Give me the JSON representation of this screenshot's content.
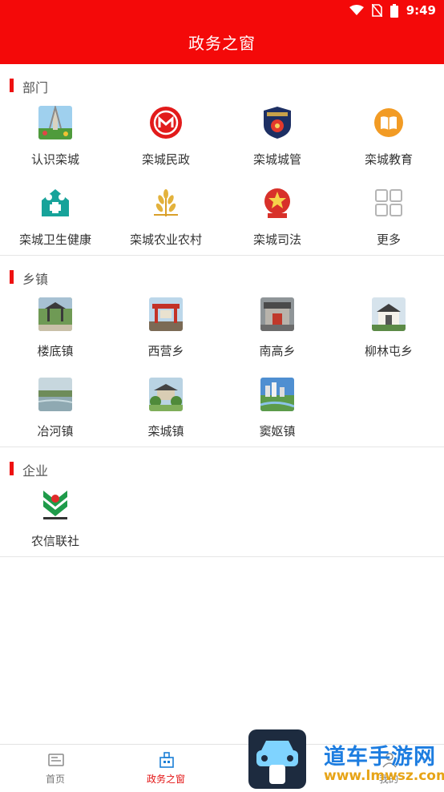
{
  "status": {
    "time": "9:49"
  },
  "header": {
    "title": "政务之窗"
  },
  "sections": {
    "dept": {
      "label": "部门",
      "items": [
        "认识栾城",
        "栾城民政",
        "栾城城管",
        "栾城教育",
        "栾城卫生健康",
        "栾城农业农村",
        "栾城司法",
        "更多"
      ]
    },
    "town": {
      "label": "乡镇",
      "items": [
        "楼底镇",
        "西营乡",
        "南高乡",
        "柳林屯乡",
        "冶河镇",
        "栾城镇",
        "窦妪镇"
      ]
    },
    "company": {
      "label": "企业",
      "items": [
        "农信联社"
      ]
    }
  },
  "nav": {
    "home": "首页",
    "gov": "政务之窗",
    "mine": "我的"
  },
  "watermark": {
    "text1": "道车手游网",
    "text2": "www.lmwsz.com"
  },
  "colors": {
    "primary": "#f40909",
    "accent": "#e31414"
  }
}
